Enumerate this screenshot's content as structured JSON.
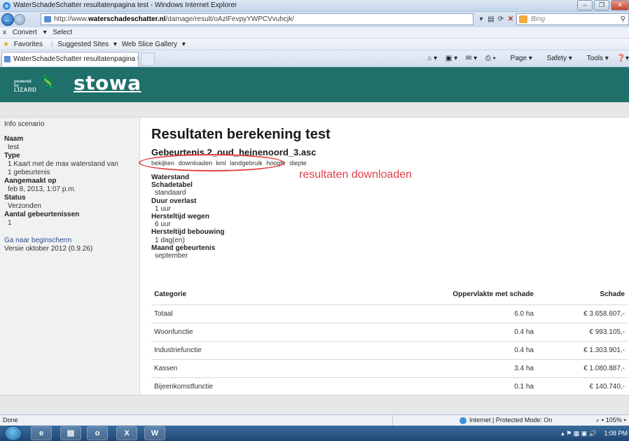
{
  "window": {
    "title": "WaterSchadeSchatter resultatenpagina test - Windows Internet Explorer"
  },
  "addressbar": {
    "url_prefix": "http://www.",
    "url_domain": "waterschadeschatter.nl",
    "url_path": "/damage/result/oAzlFevpyYWPCVvuhcjk/",
    "search_placeholder": "Bing"
  },
  "command_bar": {
    "close": "x",
    "convert": "Convert",
    "select": "Select"
  },
  "favorites_bar": {
    "favorites": "Favorites",
    "suggested_sites": "Suggested Sites",
    "web_slice_gallery": "Web Slice Gallery"
  },
  "tab": {
    "label": "WaterSchadeSchatter resultatenpagina test"
  },
  "toolbar": {
    "page": "Page",
    "safety": "Safety",
    "tools": "Tools"
  },
  "site": {
    "lizard_line1": "powered by",
    "lizard_line2": "LIZARD",
    "brand": "stowa"
  },
  "sidebar": {
    "heading": "Info scenario",
    "fields": [
      {
        "label": "Naam",
        "value": "test"
      },
      {
        "label": "Type",
        "value": "1 Kaart met de max waterstand van 1 gebeurtenis"
      },
      {
        "label": "Aangemaakt op",
        "value": "feb 8, 2013, 1:07 p.m."
      },
      {
        "label": "Status",
        "value": "Verzonden"
      },
      {
        "label": "Aantal gebeurtenissen",
        "value": "1"
      }
    ],
    "home_link": "Ga naar beginscherm",
    "version": "Versie oktober 2012 (0.9.26)"
  },
  "main": {
    "title": "Resultaten berekening test",
    "event": "Gebeurtenis 2_oud_heinenoord_3.asc",
    "links": [
      "bekijken",
      "downloaden",
      "kml",
      "landgebruik",
      "hoogte",
      "diepte"
    ],
    "annotation": "resultaten downloaden",
    "details": [
      {
        "label": "Waterstand",
        "value": ""
      },
      {
        "label": "Schadetabel",
        "value": "standaard"
      },
      {
        "label": "Duur overlast",
        "value": "1 uur"
      },
      {
        "label": "Hersteltijd wegen",
        "value": "6 uur"
      },
      {
        "label": "Hersteltijd bebouwing",
        "value": "1 dag(en)"
      },
      {
        "label": "Maand gebeurtenis",
        "value": "september"
      }
    ],
    "table": {
      "headers": [
        "Categorie",
        "Oppervlakte met schade",
        "Schade"
      ],
      "rows": [
        {
          "categorie": "Totaal",
          "oppervlakte": "6.0 ha",
          "schade": "€ 3.658.607,-"
        },
        {
          "categorie": "Woonfunctie",
          "oppervlakte": "0.4 ha",
          "schade": "€ 993.105,-"
        },
        {
          "categorie": "Industriefunctie",
          "oppervlakte": "0.4 ha",
          "schade": "€ 1.303.901,-"
        },
        {
          "categorie": "Kassen",
          "oppervlakte": "3.4 ha",
          "schade": "€ 1.080.887,-"
        },
        {
          "categorie": "Bijeenkomstfunctie",
          "oppervlakte": "0.1 ha",
          "schade": "€ 140.740,-"
        }
      ]
    }
  },
  "statusbar": {
    "status": "Done",
    "zone": "Internet | Protected Mode: On",
    "zoom": "105%"
  },
  "taskbar": {
    "time": "1:08 PM"
  },
  "colors": {
    "banner": "#1f6f6a",
    "annotation": "#e23f3f"
  }
}
